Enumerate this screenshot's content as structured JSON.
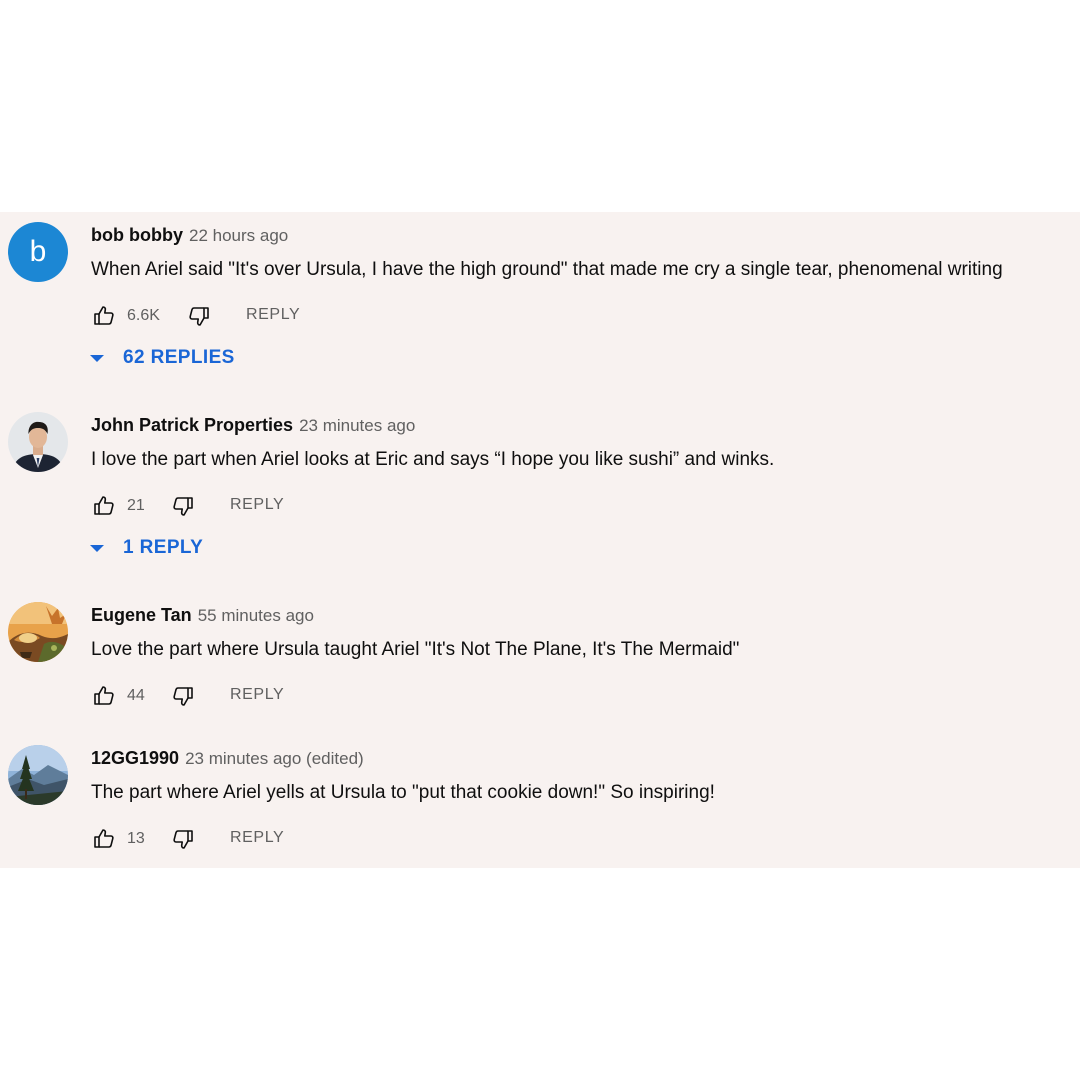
{
  "comments": [
    {
      "avatar_letter": "b",
      "avatar_color": "#1c87d4",
      "author": "bob bobby",
      "time": "22 hours ago",
      "text": "When Ariel said \"It's over Ursula, I have the high ground\" that made me cry a single tear, phenomenal writing",
      "likes": "6.6K",
      "reply_label": "REPLY",
      "replies_label": "62 REPLIES"
    },
    {
      "avatar_icon": "person-photo-avatar",
      "author": "John Patrick Properties",
      "time": "23 minutes ago",
      "text": "I love the part when Ariel looks at Eric and says “I hope you like sushi” and winks.",
      "likes": "21",
      "reply_label": "REPLY",
      "replies_label": "1 REPLY"
    },
    {
      "avatar_icon": "illustration-avatar",
      "author": "Eugene Tan",
      "time": "55 minutes ago",
      "text": "Love the part where Ursula taught Ariel \"It's Not The Plane, It's The Mermaid\"",
      "likes": "44",
      "reply_label": "REPLY"
    },
    {
      "avatar_icon": "landscape-photo-avatar",
      "author": "12GG1990",
      "time": "23 minutes ago (edited)",
      "text": "The part where Ariel yells at Ursula to \"put that cookie down!\" So inspiring!",
      "likes": "13",
      "reply_label": "REPLY"
    }
  ],
  "colors": {
    "panel_background": "#f8f2f0",
    "link_blue": "#1a66d6",
    "secondary_text": "#606060"
  }
}
